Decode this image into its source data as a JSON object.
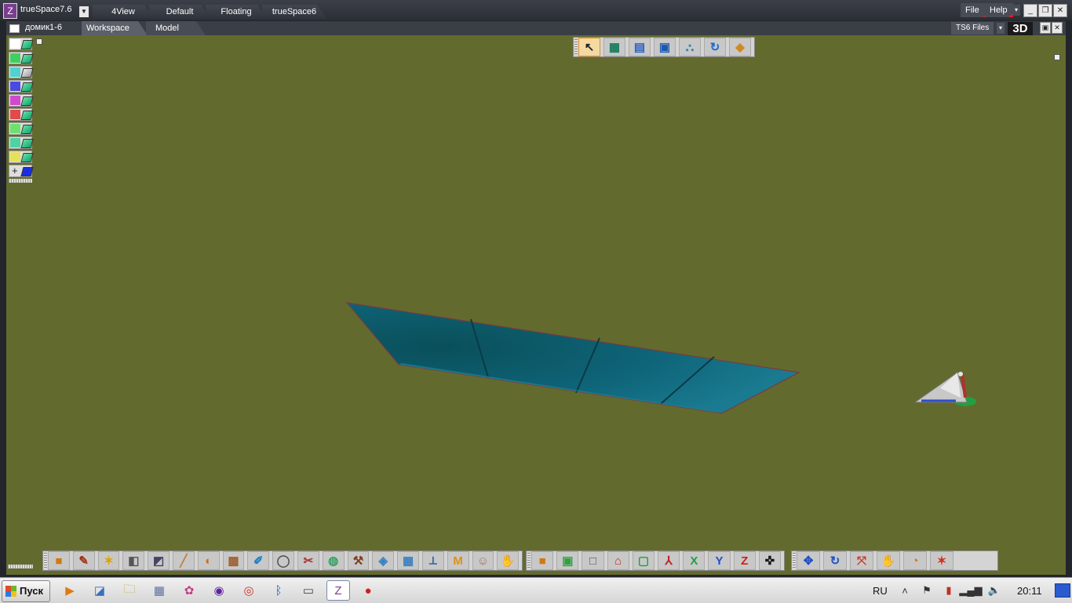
{
  "titlebar": {
    "app_name": "trueSpace7.6",
    "tabs": [
      "4View",
      "Default",
      "Floating",
      "trueSpace6"
    ],
    "menu": {
      "file": "File",
      "help": "Help"
    }
  },
  "tabbar": {
    "document": "домик1-6",
    "tabs": [
      "Workspace",
      "Model"
    ],
    "ts6_files": "TS6 Files",
    "view_mode": "3D"
  },
  "palette": {
    "colors": [
      "#ffffff",
      "#3fcf5f",
      "#4fd2d0",
      "#4a4ae0",
      "#d04ad0",
      "#e04a4a",
      "#6fe06f",
      "#4fd2a0",
      "#e6e05a"
    ],
    "add_label": "+"
  },
  "top_toolbar": {
    "icons": [
      "pointer-icon",
      "object-tool-icon",
      "grid-icon",
      "floor-icon",
      "stairs-icon",
      "rotate-icon",
      "snap-icon"
    ],
    "glyphs": [
      "↖",
      "▦",
      "▤",
      "▣",
      "⛬",
      "↻",
      "◆"
    ]
  },
  "bottom_toolbar_1": {
    "icons": [
      "cube-icon",
      "paint-icon",
      "light-icon",
      "boolean-icon",
      "deform-icon",
      "pen-icon",
      "sphere-icon",
      "texture-icon",
      "draw-icon",
      "spline-icon",
      "brush-icon",
      "material-icon",
      "tool-icon",
      "network-icon",
      "mesh-icon",
      "skeleton-icon",
      "m-icon",
      "face-icon",
      "user-icon"
    ],
    "glyphs": [
      "■",
      "✎",
      "✶",
      "◧",
      "◩",
      "╱",
      "◐",
      "▩",
      "✐",
      "◯",
      "✂",
      "◍",
      "⚒",
      "◈",
      "▦",
      "⟂",
      "M",
      "☺",
      "✋"
    ]
  },
  "bottom_toolbar_2": {
    "icons": [
      "object-icon",
      "box-icon",
      "rectangle-icon",
      "house-icon",
      "frame-icon",
      "axes-icon",
      "x-axis-icon",
      "y-axis-icon",
      "z-axis-icon",
      "center-icon"
    ],
    "glyphs": [
      "■",
      "▣",
      "□",
      "⌂",
      "▢",
      "⅄",
      "X",
      "Y",
      "Z",
      "✜"
    ]
  },
  "bottom_toolbar_3": {
    "icons": [
      "move-icon",
      "rotate-obj-icon",
      "scale-icon",
      "pan-icon",
      "orbit-icon",
      "zoom-icon"
    ],
    "glyphs": [
      "✥",
      "↻",
      "⤧",
      "✋",
      "◔",
      "✶"
    ]
  },
  "taskbar": {
    "start_label": "Пуск",
    "apps": [
      "media-player-icon",
      "explorer-icon",
      "folder-icon",
      "calculator-icon",
      "paint-icon",
      "tor-icon",
      "chrome-icon",
      "bluetooth-icon",
      "window-icon",
      "truespace-icon",
      "recorder-icon"
    ],
    "glyphs": [
      "▶",
      "◪",
      "🗀",
      "▦",
      "✿",
      "◉",
      "◎",
      "ᛒ",
      "▭",
      "Z",
      "●"
    ],
    "language": "RU",
    "time": "20:11"
  }
}
